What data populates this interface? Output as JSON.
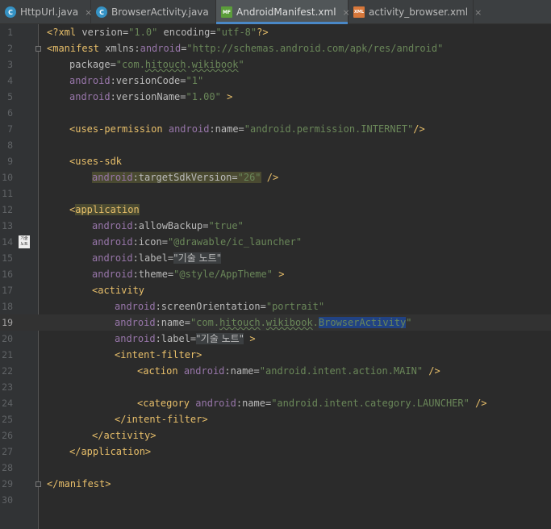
{
  "tabs": [
    {
      "label": "HttpUrl.java",
      "icon": "C",
      "active": false
    },
    {
      "label": "BrowserActivity.java",
      "icon": "C",
      "active": false
    },
    {
      "label": "AndroidManifest.xml",
      "icon": "MF",
      "active": true
    },
    {
      "label": "activity_browser.xml",
      "icon": "XML",
      "active": false
    }
  ],
  "close_glyph": "×",
  "gutter_badge": "기술\n노트",
  "line_numbers": [
    "1",
    "2",
    "3",
    "4",
    "5",
    "6",
    "7",
    "8",
    "9",
    "10",
    "11",
    "12",
    "13",
    "14",
    "15",
    "16",
    "17",
    "18",
    "19",
    "20",
    "21",
    "22",
    "23",
    "24",
    "25",
    "26",
    "27",
    "28",
    "29",
    "30"
  ],
  "current_line": 19,
  "code": {
    "l1": {
      "open": "<?",
      "tag": "xml",
      "a1": " version=",
      "v1": "\"1.0\"",
      "a2": " encoding=",
      "v2": "\"utf-8\"",
      "close": "?>"
    },
    "l2": {
      "open": "<",
      "tag": "manifest",
      "a1": " xmlns:",
      "ns": "android",
      "eq": "=",
      "v1": "\"http://schemas.android.com/apk/res/android\""
    },
    "l3": {
      "attr": "package=",
      "v_pre": "\"com.",
      "v_ul1": "hitouch",
      "v_mid": ".",
      "v_ul2": "wikibook",
      "v_post": "\""
    },
    "l4": {
      "ns": "android",
      "attr": ":versionCode=",
      "v": "\"1\""
    },
    "l5": {
      "ns": "android",
      "attr": ":versionName=",
      "v": "\"1.00\"",
      "close": " >"
    },
    "l7": {
      "open": "<",
      "tag": "uses-permission",
      "sp": " ",
      "ns": "android",
      "attr": ":name=",
      "v": "\"android.permission.INTERNET\"",
      "close": "/>"
    },
    "l9": {
      "open": "<",
      "tag": "uses-sdk"
    },
    "l10": {
      "ns": "android",
      "attr": ":targetSdkVersion=",
      "v": "\"26\"",
      "close": " />"
    },
    "l12": {
      "open": "<",
      "tag": "application"
    },
    "l13": {
      "ns": "android",
      "attr": ":allowBackup=",
      "v": "\"true\""
    },
    "l14": {
      "ns": "android",
      "attr": ":icon=",
      "v": "\"@drawable/ic_launcher\""
    },
    "l15": {
      "ns": "android",
      "attr": ":label=",
      "v": "\"기술 노트\""
    },
    "l16": {
      "ns": "android",
      "attr": ":theme=",
      "v": "\"@style/AppTheme\"",
      "close": " >"
    },
    "l17": {
      "open": "<",
      "tag": "activity"
    },
    "l18": {
      "ns": "android",
      "attr": ":screenOrientation=",
      "v": "\"portrait\""
    },
    "l19": {
      "ns": "android",
      "attr": ":name=",
      "v_pre": "\"com.",
      "v_ul1": "hitouch",
      "v_mid": ".",
      "v_ul2": "wikibook",
      "v_dot": ".",
      "v_sel": "BrowserActivity",
      "v_post": "\""
    },
    "l20": {
      "ns": "android",
      "attr": ":label=",
      "v": "\"기술 노트\"",
      "close": " >"
    },
    "l21": {
      "open": "<",
      "tag": "intent-filter",
      "close": ">"
    },
    "l22": {
      "open": "<",
      "tag": "action",
      "sp": " ",
      "ns": "android",
      "attr": ":name=",
      "v": "\"android.intent.action.MAIN\"",
      "close": " />"
    },
    "l24": {
      "open": "<",
      "tag": "category",
      "sp": " ",
      "ns": "android",
      "attr": ":name=",
      "v": "\"android.intent.category.LAUNCHER\"",
      "close": " />"
    },
    "l25": {
      "text": "</intent-filter>"
    },
    "l26": {
      "text": "</activity>"
    },
    "l27": {
      "text": "</application>"
    },
    "l29": {
      "text": "</manifest>"
    }
  }
}
